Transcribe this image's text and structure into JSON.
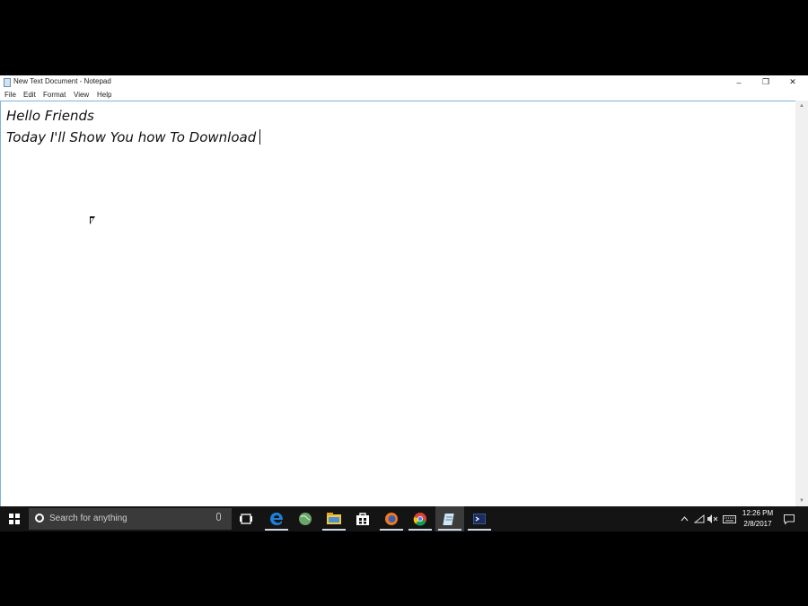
{
  "window": {
    "title": "New Text Document - Notepad",
    "controls": {
      "minimize": "–",
      "restore": "❐",
      "close": "✕"
    }
  },
  "menu": [
    "File",
    "Edit",
    "Format",
    "View",
    "Help"
  ],
  "editor": {
    "lines": [
      "Hello Friends",
      "Today I'll Show You how To Download"
    ]
  },
  "taskbar": {
    "search_placeholder": "Search for anything",
    "apps": [
      "task-view",
      "edge",
      "globe",
      "file-explorer",
      "store",
      "firefox",
      "chrome",
      "notepad",
      "terminal"
    ],
    "active_app": "notepad",
    "clock": {
      "time": "12:26 PM",
      "date": "2/8/2017"
    }
  },
  "colors": {
    "taskbar_bg": "#141414",
    "editor_border": "#7fb2d8",
    "edge_blue": "#1e7fd6",
    "firefox_orange": "#f17a1f"
  }
}
